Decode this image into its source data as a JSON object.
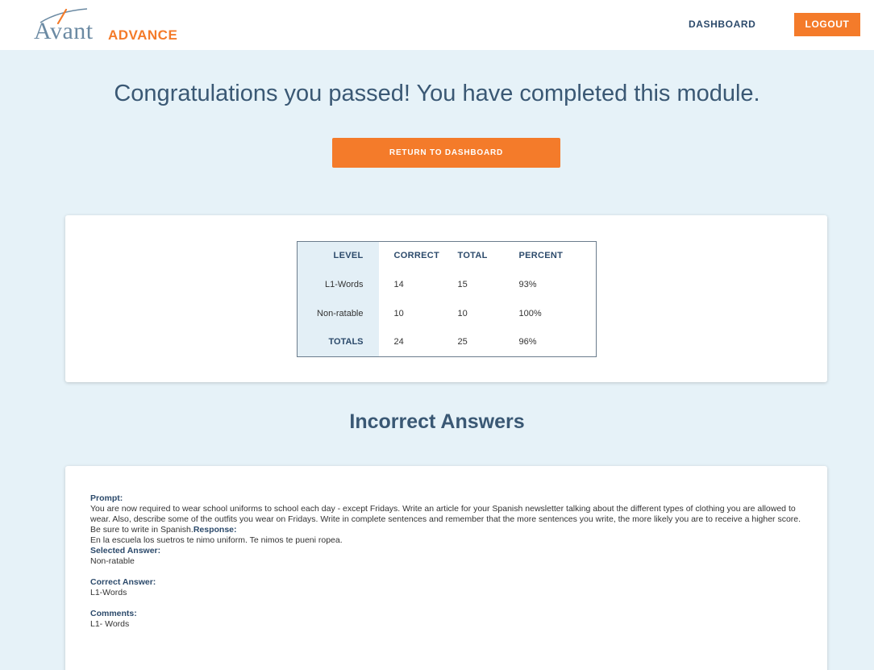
{
  "header": {
    "logo_text": "Avant",
    "logo_sub": "ADVANCE",
    "nav_dashboard": "DASHBOARD",
    "logout_label": "LOGOUT"
  },
  "main": {
    "title": "Congratulations you passed! You have completed this module.",
    "return_label": "RETURN TO DASHBOARD"
  },
  "results": {
    "headers": [
      "LEVEL",
      "CORRECT",
      "TOTAL",
      "PERCENT"
    ],
    "rows": [
      {
        "level": "L1-Words",
        "correct": "14",
        "total": "15",
        "percent": "93%"
      },
      {
        "level": "Non-ratable",
        "correct": "10",
        "total": "10",
        "percent": "100%"
      },
      {
        "level": "TOTALS",
        "correct": "24",
        "total": "25",
        "percent": "96%"
      }
    ]
  },
  "incorrect": {
    "title": "Incorrect Answers",
    "prompt_label": "Prompt:",
    "prompt_text": "You are now required to wear school uniforms to school each day - except Fridays. Write an article for your Spanish newsletter talking about the different types of clothing you are allowed to wear. Also, describe some of the outfits you wear on Fridays. Write in complete sentences and remember that the more sentences you write, the more likely you are to receive a higher score. Be sure to write in Spanish.",
    "response_label": "Response:",
    "response_text": "En la escuela los suetros te nimo uniform. Te nimos te pueni ropea.",
    "selected_label": "Selected Answer:",
    "selected_value": "Non-ratable",
    "correct_label": "Correct Answer:",
    "correct_value": "L1-Words",
    "comments_label": "Comments:",
    "comments_value": "L1- Words"
  },
  "colors": {
    "accent": "#f47b2a",
    "background": "#e6f2f8",
    "heading": "#3a5874"
  }
}
